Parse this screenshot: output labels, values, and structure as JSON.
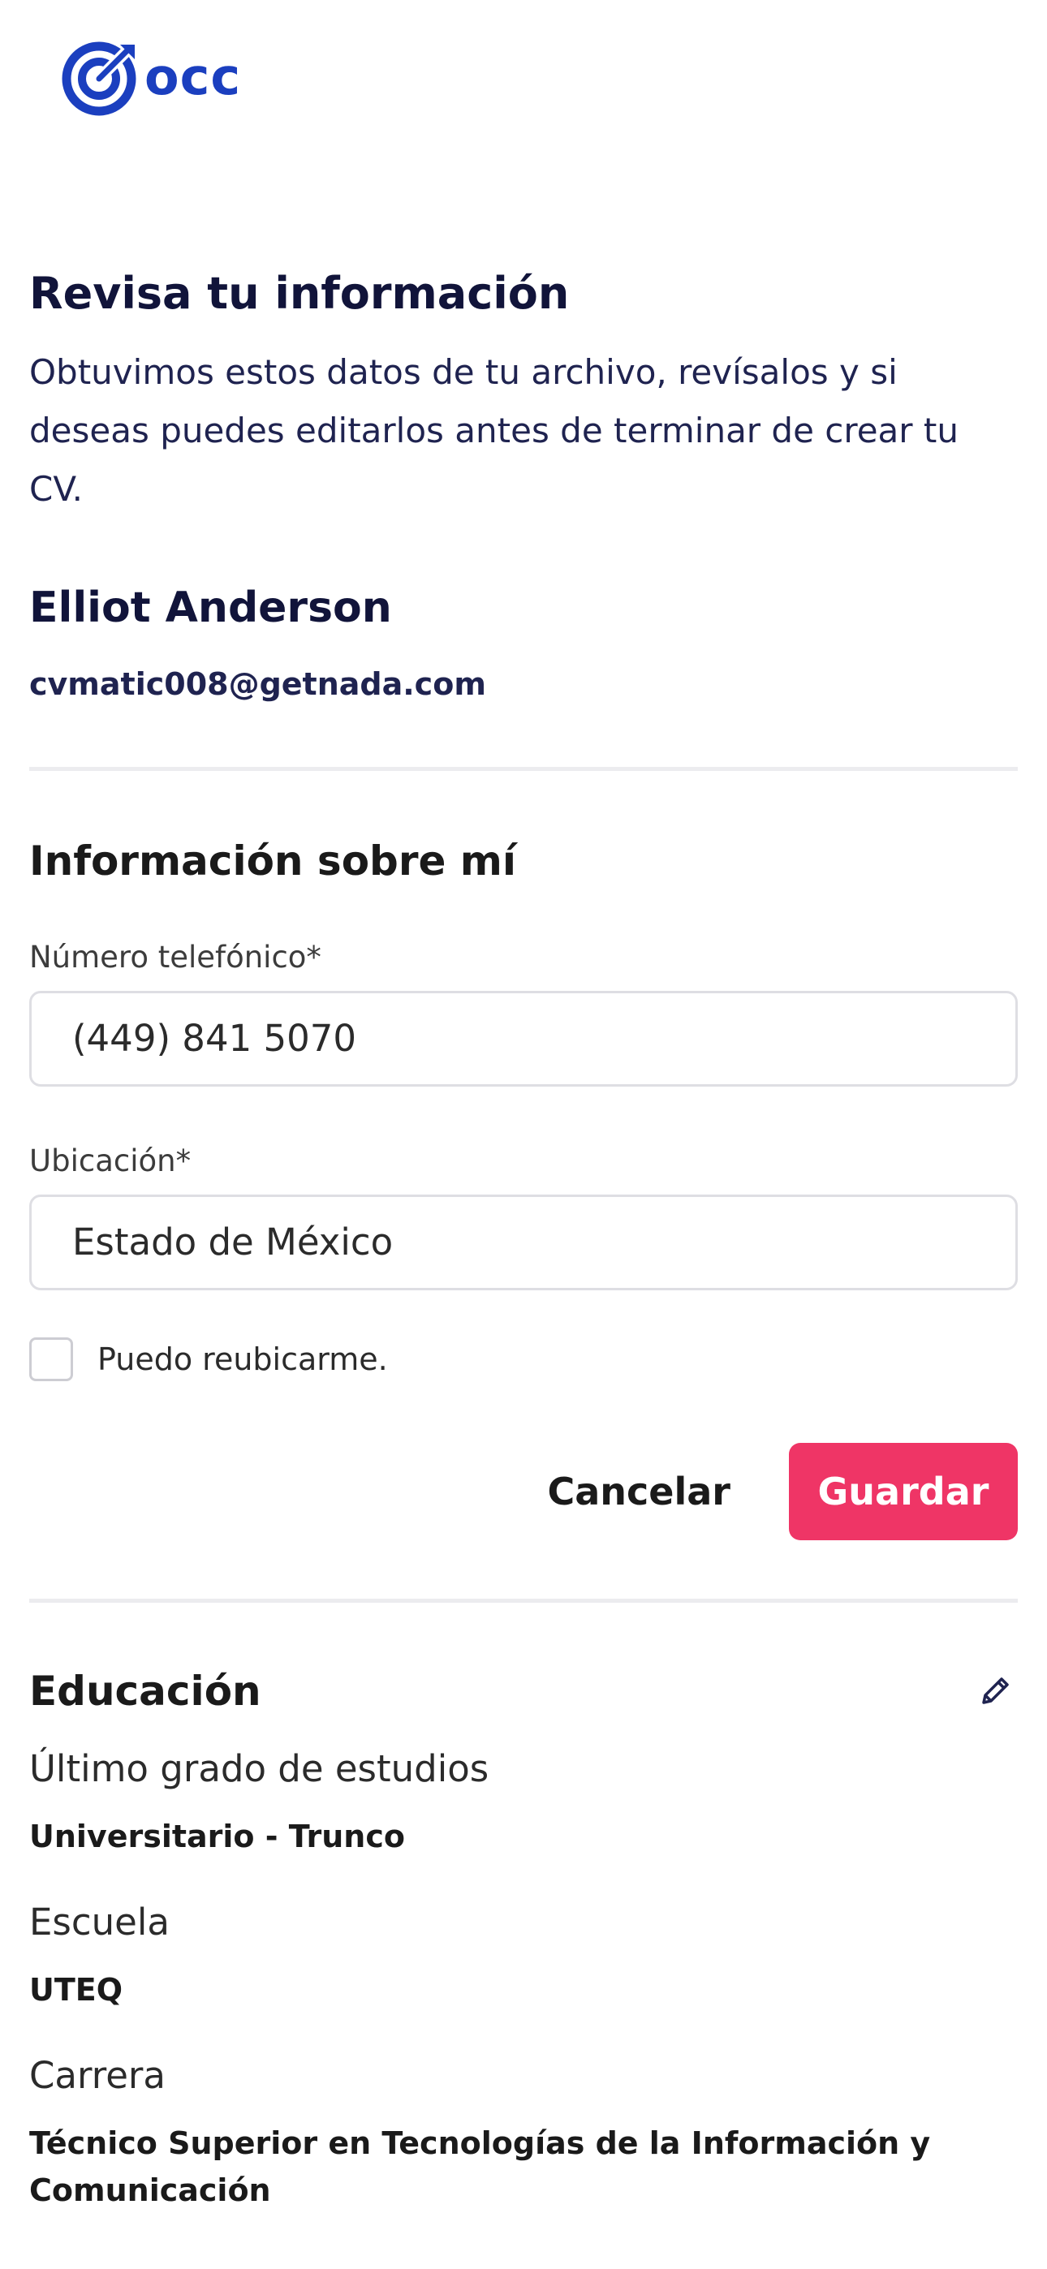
{
  "brand": {
    "logo_text": "occ",
    "logo_icon": "target-icon",
    "color": "#1b3fbf"
  },
  "intro": {
    "title": "Revisa tu información",
    "text": "Obtuvimos estos datos de tu archivo, revísalos y si deseas puedes editarlos antes de terminar de crear tu CV."
  },
  "user": {
    "name": "Elliot Anderson",
    "email": "cvmatic008@getnada.com"
  },
  "about": {
    "title": "Información sobre mí",
    "phone_label": "Número telefónico*",
    "phone_value": "(449) 841 5070",
    "location_label": "Ubicación*",
    "location_value": "Estado de México",
    "relocate_label": "Puedo reubicarme.",
    "relocate_checked": false,
    "cancel_label": "Cancelar",
    "save_label": "Guardar",
    "save_color": "#ef3566"
  },
  "education": {
    "title": "Educación",
    "edit_icon": "pencil-icon",
    "degree_label": "Último grado de estudios",
    "degree_value": "Universitario - Trunco",
    "school_label": "Escuela",
    "school_value": "UTEQ",
    "career_label": "Carrera",
    "career_value": "Técnico Superior en Tecnologías de la Información y Comunicación"
  }
}
